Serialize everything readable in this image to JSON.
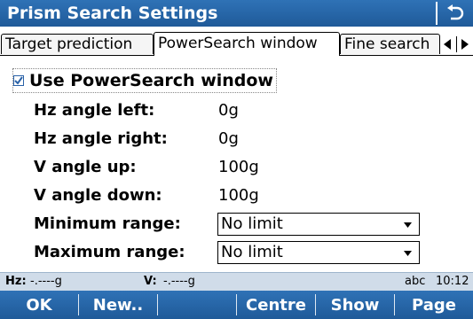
{
  "window": {
    "title": "Prism Search Settings",
    "back_icon": "return-arrow-icon"
  },
  "tabs": [
    {
      "label": "Target prediction",
      "active": false
    },
    {
      "label": "PowerSearch window",
      "active": true
    },
    {
      "label": "Fine search",
      "active": false
    }
  ],
  "tab_scroll": {
    "left_icon": "triangle-left-icon",
    "right_icon": "triangle-right-icon"
  },
  "checkbox": {
    "label": "Use PowerSearch window",
    "checked": true
  },
  "fields": {
    "hz_left": {
      "label": "Hz angle left:",
      "value": "0g"
    },
    "hz_right": {
      "label": "Hz angle right:",
      "value": "0g"
    },
    "v_up": {
      "label": "V angle up:",
      "value": "100g"
    },
    "v_down": {
      "label": "V angle down:",
      "value": "100g"
    },
    "min_range": {
      "label": "Minimum range:",
      "value": "No limit"
    },
    "max_range": {
      "label": "Maximum range:",
      "value": "No limit"
    }
  },
  "status": {
    "hz_label": "Hz:",
    "hz_value": "-.----g",
    "v_label": "V:",
    "v_value": "-.----g",
    "input_mode": "abc",
    "time": "10:12"
  },
  "softkeys": {
    "ok": "OK",
    "new": "New..",
    "centre": "Centre",
    "show": "Show",
    "page": "Page"
  },
  "colors": {
    "bar_blue": "#1f5a99",
    "status_bg": "#d0dce9"
  }
}
